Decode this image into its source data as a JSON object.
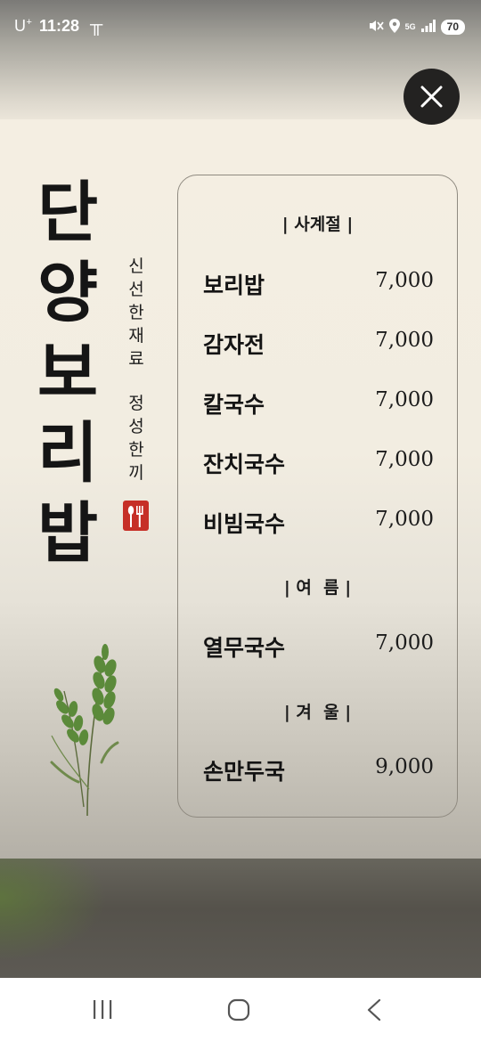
{
  "status_bar": {
    "carrier": "U",
    "carrier_sup": "+",
    "time": "11:28",
    "notification_icon": "tt-icon",
    "icons": [
      "mute-icon",
      "location-icon",
      "5g-signal-icon",
      "signal-bars-icon"
    ],
    "network": "5G",
    "battery": "70"
  },
  "menu": {
    "brand": [
      "단",
      "양",
      "보",
      "리",
      "밥"
    ],
    "slogan_line1": [
      "신",
      "선",
      "한",
      "재",
      "료"
    ],
    "slogan_line2": [
      "정",
      "성",
      "한",
      "끼"
    ],
    "sections": [
      {
        "heading": "| 사계절 |",
        "items": [
          {
            "name": "보리밥",
            "price": "7,000"
          },
          {
            "name": "감자전",
            "price": "7,000"
          },
          {
            "name": "칼국수",
            "price": "7,000"
          },
          {
            "name": "잔치국수",
            "price": "7,000"
          },
          {
            "name": "비빔국수",
            "price": "7,000"
          }
        ]
      },
      {
        "heading": "| 여  름 |",
        "items": [
          {
            "name": "열무국수",
            "price": "7,000"
          }
        ]
      },
      {
        "heading": "| 겨  울 |",
        "items": [
          {
            "name": "손만두국",
            "price": "9,000"
          }
        ]
      }
    ]
  },
  "close_button_icon": "close-icon",
  "nav_bar": {
    "recent_apps_icon": "recent-apps-icon",
    "home_icon": "home-icon",
    "back_icon": "back-icon"
  },
  "colors": {
    "stamp": "#c62f27",
    "close_bg": "#232221",
    "wheat": "#5b8a3a"
  }
}
